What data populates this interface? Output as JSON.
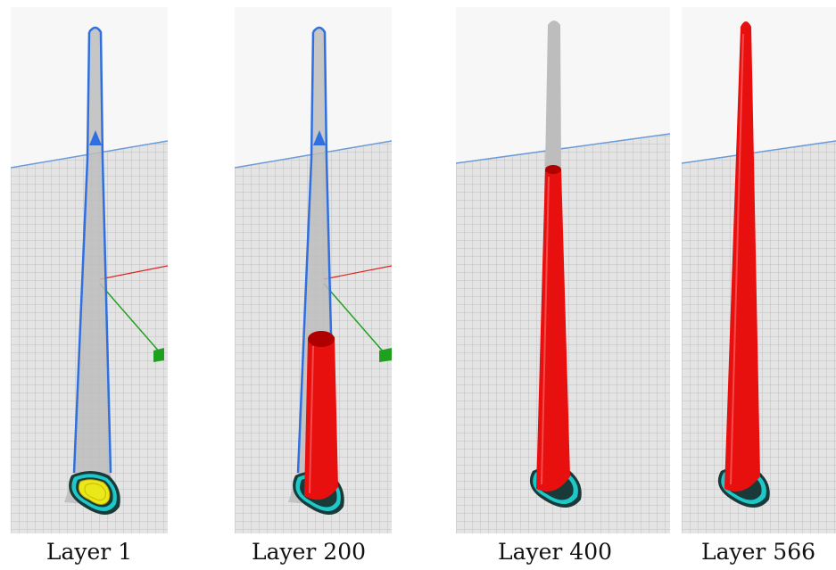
{
  "captions": [
    "Layer 1",
    "Layer 200",
    "Layer 400",
    "Layer 566"
  ],
  "colors": {
    "background": "#f7f7f7",
    "grid_floor": "#e4e4e4",
    "grid_line": "#c0c0c0",
    "horizon": "#6a9bd8",
    "outline": "#2f6fe0",
    "printed": "#e80f0f",
    "unprinted": "#bdbdbd",
    "skirt_cyan": "#1fc8c8",
    "skirt_dark": "#1a3a3a",
    "first_layer": "#e8e81a",
    "axis_x": "#e02020",
    "axis_y": "#20a020"
  },
  "icons": [
    "z-axis-arrow-icon",
    "origin-axes-icon"
  ]
}
